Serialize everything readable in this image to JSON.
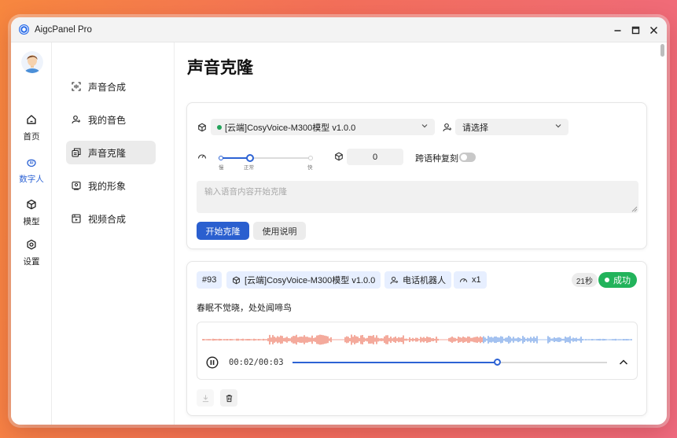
{
  "app": {
    "title": "AigcPanel Pro"
  },
  "nav": {
    "items": [
      {
        "label": "首页",
        "icon": "home-icon"
      },
      {
        "label": "数字人",
        "icon": "ai-icon"
      },
      {
        "label": "模型",
        "icon": "cube-icon"
      },
      {
        "label": "设置",
        "icon": "gear-icon"
      }
    ],
    "active": "数字人"
  },
  "subnav": {
    "items": [
      {
        "label": "声音合成",
        "icon": "voice-scan-icon"
      },
      {
        "label": "我的音色",
        "icon": "user-voice-icon"
      },
      {
        "label": "声音克隆",
        "icon": "copy-icon"
      },
      {
        "label": "我的形象",
        "icon": "image-icon"
      },
      {
        "label": "视频合成",
        "icon": "video-icon"
      }
    ],
    "active": "声音克隆"
  },
  "page": {
    "title": "声音克隆"
  },
  "form": {
    "model_select": "[云端]CosyVoice-M300模型 v1.0.0",
    "voice_select": "请选择",
    "speed": {
      "min_label": "慢",
      "mid_label": "正常",
      "max_label": "快",
      "value_fraction": 0.33
    },
    "seed_value": "0",
    "cross_lingual_label": "跨语种复刻",
    "cross_lingual_on": false,
    "text_placeholder": "输入语音内容开始克隆",
    "submit_label": "开始克隆",
    "help_label": "使用说明"
  },
  "task": {
    "id": "#93",
    "model": "[云端]CosyVoice-M300模型 v1.0.0",
    "voice": "电话机器人",
    "speed": "x1",
    "duration": "21秒",
    "status": "成功",
    "text": "春眠不觉晓，处处闻啼鸟",
    "player": {
      "time": "00:02/00:03",
      "progress_fraction": 0.65
    }
  },
  "colors": {
    "accent": "#2d63d4",
    "primary_button": "#2a5fcf",
    "success": "#22b35b",
    "wave_played": "#e8553a",
    "wave_unplayed": "#4a86e0",
    "tag_bg": "#e7efff"
  }
}
